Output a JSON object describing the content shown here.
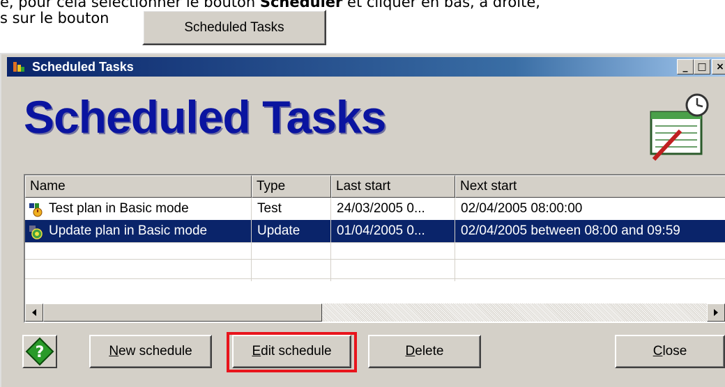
{
  "doc": {
    "line1_pre": "e, pour cela sélectionner le bouton ",
    "line1_bold": "Scheduler",
    "line1_post": " et cliquer en bas, à droite,",
    "line2": "s sur le bouton",
    "reference_button_label": "Scheduled Tasks"
  },
  "window": {
    "title": "Scheduled Tasks",
    "heading": "Scheduled Tasks",
    "controls": {
      "minimize": "_",
      "maximize": "□",
      "close": "×"
    }
  },
  "table": {
    "columns": [
      "Name",
      "Type",
      "Last start",
      "Next start"
    ],
    "rows": [
      {
        "name": "Test plan in Basic mode",
        "type": "Test",
        "last_start": "24/03/2005 0...",
        "next_start": "02/04/2005 08:00:00",
        "selected": false
      },
      {
        "name": "Update plan in Basic mode",
        "type": "Update",
        "last_start": "01/04/2005 0...",
        "next_start": "02/04/2005 between 08:00 and 09:59",
        "selected": true
      }
    ]
  },
  "buttons": {
    "new_schedule": {
      "mnemonic": "N",
      "rest": "ew schedule"
    },
    "edit_schedule": {
      "mnemonic": "E",
      "rest": "dit schedule"
    },
    "delete": {
      "mnemonic": "D",
      "rest": "elete"
    },
    "close": {
      "mnemonic": "C",
      "rest": "lose"
    }
  },
  "colors": {
    "heading": "#0a14a0",
    "selection": "#0a246a",
    "highlight": "#e8141c"
  },
  "icons": {
    "app": "calendar-clock-icon",
    "help": "help-diamond-icon",
    "test_task": "test-task-icon",
    "update_task": "update-task-icon"
  }
}
